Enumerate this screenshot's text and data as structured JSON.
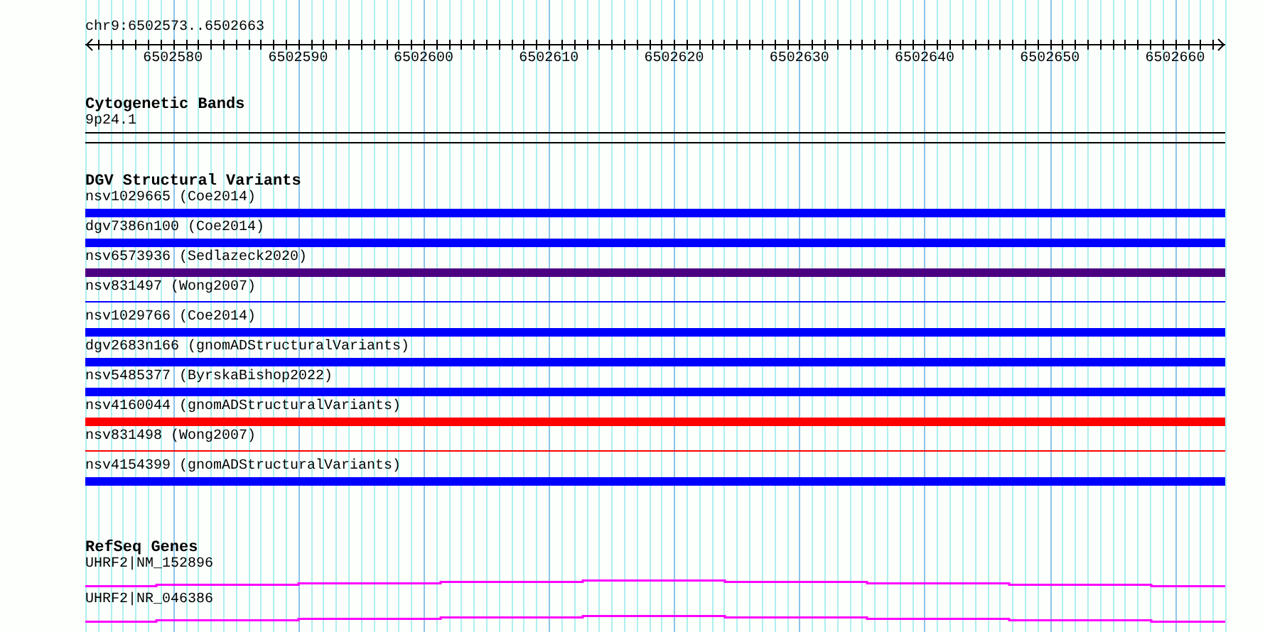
{
  "location": "chr9:6502573..6502663",
  "ruler": {
    "labels": [
      "6502580",
      "6502590",
      "6502600",
      "6502610",
      "6502620",
      "6502630",
      "6502640",
      "6502650",
      "6502660"
    ]
  },
  "cytobands": {
    "title": "Cytogenetic Bands",
    "features": [
      "9p24.1"
    ]
  },
  "dgv": {
    "title": "DGV Structural Variants",
    "features": [
      {
        "label": "nsv1029665 (Coe2014)",
        "kind": "thick",
        "color": "#0000ff"
      },
      {
        "label": "dgv7386n100 (Coe2014)",
        "kind": "thick",
        "color": "#0000ff"
      },
      {
        "label": "nsv6573936 (Sedlazeck2020)",
        "kind": "thick",
        "color": "#4b0082"
      },
      {
        "label": "nsv831497 (Wong2007)",
        "kind": "thin",
        "color": "#0000ff"
      },
      {
        "label": "nsv1029766 (Coe2014)",
        "kind": "thick",
        "color": "#0000ff"
      },
      {
        "label": "dgv2683n166 (gnomADStructuralVariants)",
        "kind": "thick",
        "color": "#0000ff"
      },
      {
        "label": "nsv5485377 (ByrskaBishop2022)",
        "kind": "thick",
        "color": "#0000ff"
      },
      {
        "label": "nsv4160044 (gnomADStructuralVariants)",
        "kind": "thick",
        "color": "#ff0000"
      },
      {
        "label": "nsv831498 (Wong2007)",
        "kind": "thin",
        "color": "#ff0000"
      },
      {
        "label": "nsv4154399 (gnomADStructuralVariants)",
        "kind": "thick",
        "color": "#0000ff"
      }
    ]
  },
  "refseq": {
    "title": "RefSeq Genes",
    "features": [
      {
        "label": "UHRF2|NM_152896"
      },
      {
        "label": "UHRF2|NR_046386"
      }
    ]
  }
}
